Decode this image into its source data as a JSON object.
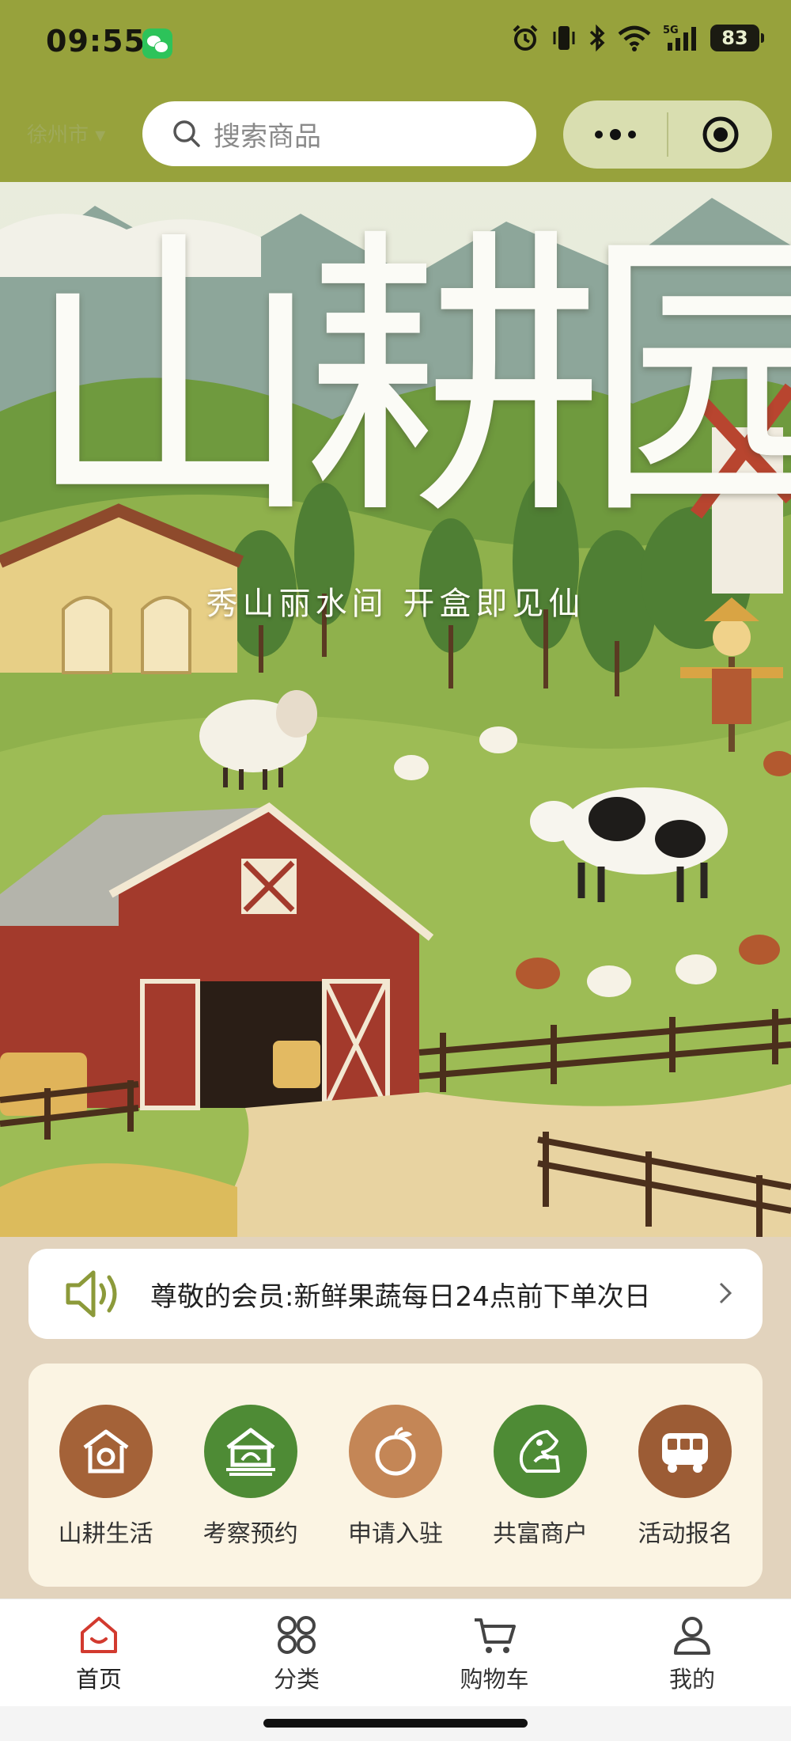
{
  "status_bar": {
    "time": "09:55",
    "battery": "83",
    "network": "5G"
  },
  "header": {
    "location": "徐州市",
    "search_placeholder": "搜索商品",
    "more_icon": "more-dots-icon",
    "close_icon": "target-circle-icon"
  },
  "banner": {
    "brand": "山耕园",
    "slogan": "秀山丽水间 开盒即见仙"
  },
  "notice": {
    "text": "尊敬的会员:新鲜果蔬每日24点前下单次日"
  },
  "quick_menu": [
    {
      "label": "山耕生活",
      "icon": "home-house-icon",
      "color": "#a46238"
    },
    {
      "label": "考察预约",
      "icon": "farm-building-icon",
      "color": "#4e8b35"
    },
    {
      "label": "申请入驻",
      "icon": "orange-fruit-icon",
      "color": "#c48656"
    },
    {
      "label": "共富商户",
      "icon": "hand-leaf-icon",
      "color": "#4e8b35"
    },
    {
      "label": "活动报名",
      "icon": "bus-icon",
      "color": "#9c5c35"
    }
  ],
  "tabbar": [
    {
      "label": "首页",
      "icon": "home-icon",
      "active": true
    },
    {
      "label": "分类",
      "icon": "grid-icon",
      "active": false
    },
    {
      "label": "购物车",
      "icon": "cart-icon",
      "active": false
    },
    {
      "label": "我的",
      "icon": "user-icon",
      "active": false
    }
  ],
  "colors": {
    "header": "#97a23c",
    "page_bg": "#e2d3bd",
    "active_tab": "#d23a2f"
  }
}
